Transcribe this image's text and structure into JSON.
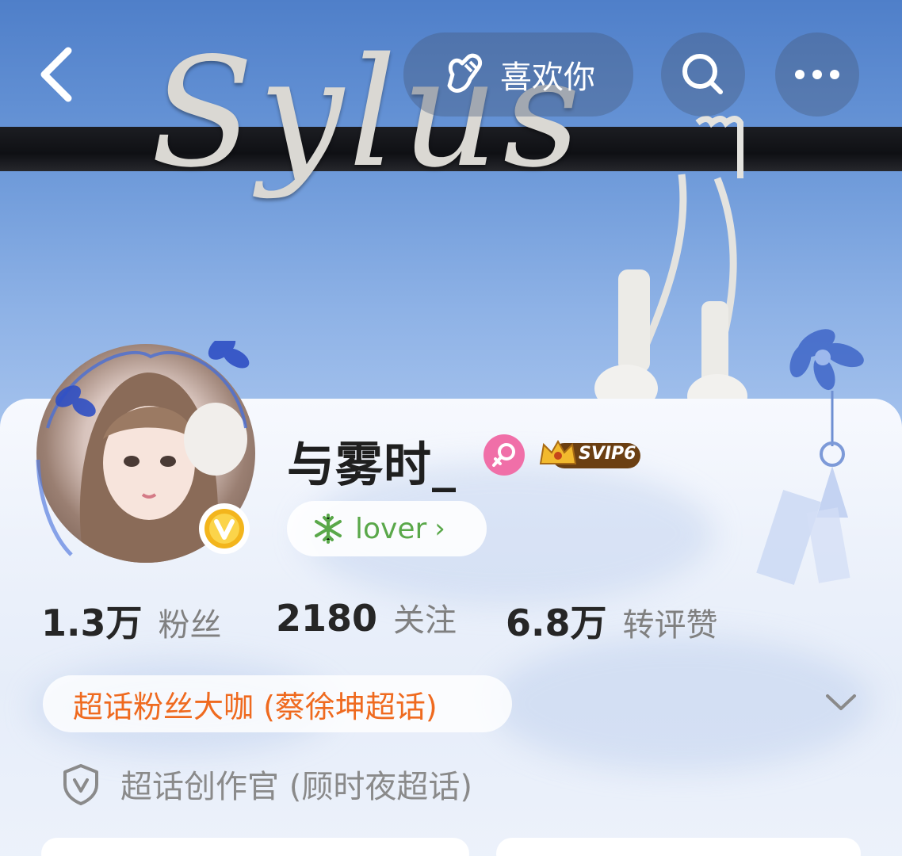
{
  "header": {
    "back_icon": "chevron-left-icon",
    "like_button": {
      "icon": "heart-hand-icon",
      "label": "喜欢你"
    },
    "search_icon": "search-icon",
    "more_icon": "more-horizontal-icon"
  },
  "cover": {
    "wire_text": "Sylus"
  },
  "profile": {
    "name": "与雾时_",
    "gender_icon": "female-icon",
    "gender_color": "#f06fa8",
    "vip_badge": "SVIP6",
    "verified_icon": "verified-v-icon",
    "tag": {
      "icon": "snowflake-icon",
      "label": "lover",
      "arrow": "›"
    }
  },
  "stats": [
    {
      "value": "1.3万",
      "label": "粉丝"
    },
    {
      "value": "2180",
      "label": "关注"
    },
    {
      "value": "6.8万",
      "label": "转评赞"
    }
  ],
  "badges": {
    "super_fan": "超话粉丝大咖 (蔡徐坤超话)",
    "creator": "超话创作官 (顾时夜超话)"
  },
  "colors": {
    "badge_orange": "#ef6a1f",
    "tag_green": "#5aa84a",
    "verified_gold": "#f3b51c"
  }
}
